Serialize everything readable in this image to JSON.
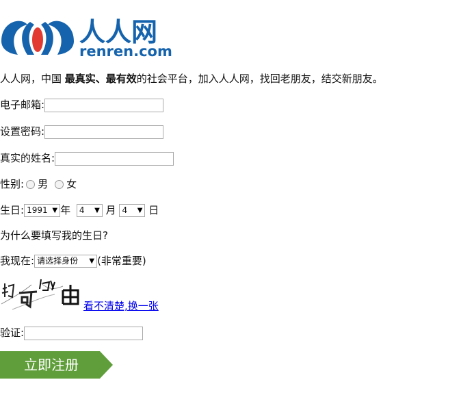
{
  "logo": {
    "cn_text": "人人网",
    "en_text": "renren.com"
  },
  "intro": {
    "part1": "人人网，中国 ",
    "bold": "最真实、最有效",
    "part2": "的社会平台，加入人人网，找回老朋友，结交新朋友。"
  },
  "form": {
    "email_label": "电子邮箱:",
    "email_value": "",
    "password_label": "设置密码:",
    "password_value": "",
    "name_label": "真实的姓名:",
    "name_value": "",
    "gender_label": "性别:",
    "gender_male": "男",
    "gender_female": "女",
    "birthday_label": "生日:",
    "birth_year": "1991",
    "year_unit": "年",
    "birth_month": "4",
    "month_unit": "月",
    "birth_day": "4",
    "day_unit": "日",
    "birthday_question": "为什么要填写我的生日?",
    "status_label": "我现在:",
    "status_select": "请选择身份",
    "status_note": "(非常重要)",
    "captcha_refresh": "看不清楚,换一张",
    "verify_label": "验证:",
    "verify_value": "",
    "submit_label": "立即注册"
  },
  "colors": {
    "logo_blue": "#1563ad",
    "logo_red": "#e23a30",
    "button_green": "#5f9e3a",
    "link_blue": "#0000ee"
  }
}
